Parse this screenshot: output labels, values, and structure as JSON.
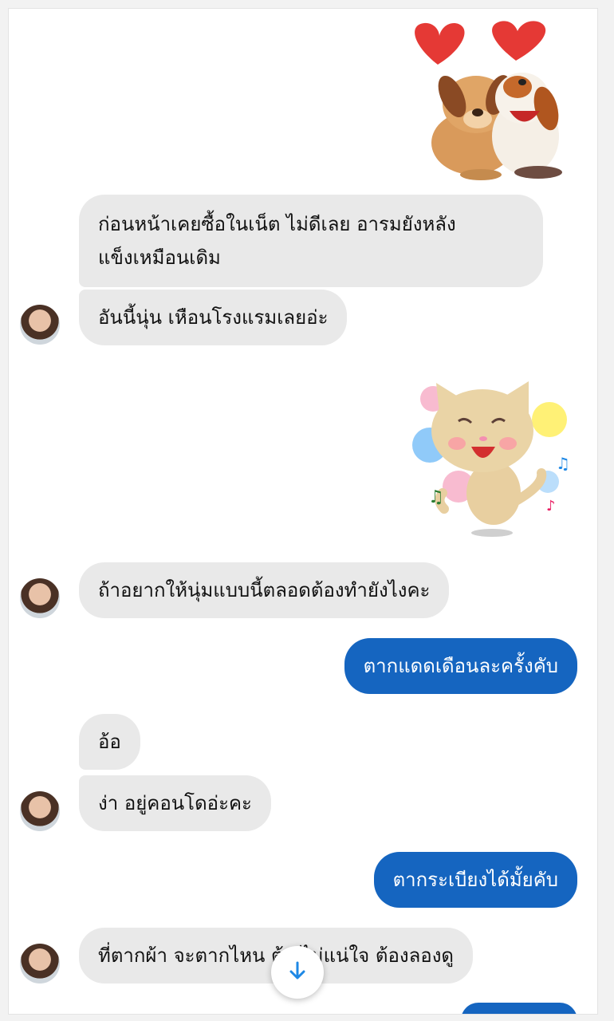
{
  "messages": [
    {
      "text": "ก่อนหน้าเคยซื้อในเน็ต ไม่ดีเลย อารมยังหลัง"
    },
    {
      "text": "แข็งเหมือนเดิม"
    },
    {
      "text": "อันนี้นุ่น เหือนโรงแรมเลยอ่ะ"
    },
    {
      "text": "ถ้าอยากให้นุ่มแบบนี้ตลอดต้องทำยังไงคะ"
    },
    {
      "text": "ตากแดดเดือนละครั้งคับ"
    },
    {
      "text": "อ้อ"
    },
    {
      "text": "ง่า อยู่คอนโดอ่ะคะ"
    },
    {
      "text": "ตากระเบียงได้มั้ยคับ"
    },
    {
      "text": "ที่ตากผ้า จะตากไหน ต้อ ไม่แน่ใจ ต้องลองดู"
    }
  ],
  "stickers": [
    {
      "name": "dogs-hug-hearts"
    },
    {
      "name": "happy-cat-dancing"
    }
  ],
  "scroll_button": {
    "icon": "arrow-down-icon"
  },
  "colors": {
    "incoming_bubble": "#e9e9e9",
    "outgoing_bubble": "#1565c0",
    "background": "#ffffff",
    "accent": "#1e88e5"
  }
}
